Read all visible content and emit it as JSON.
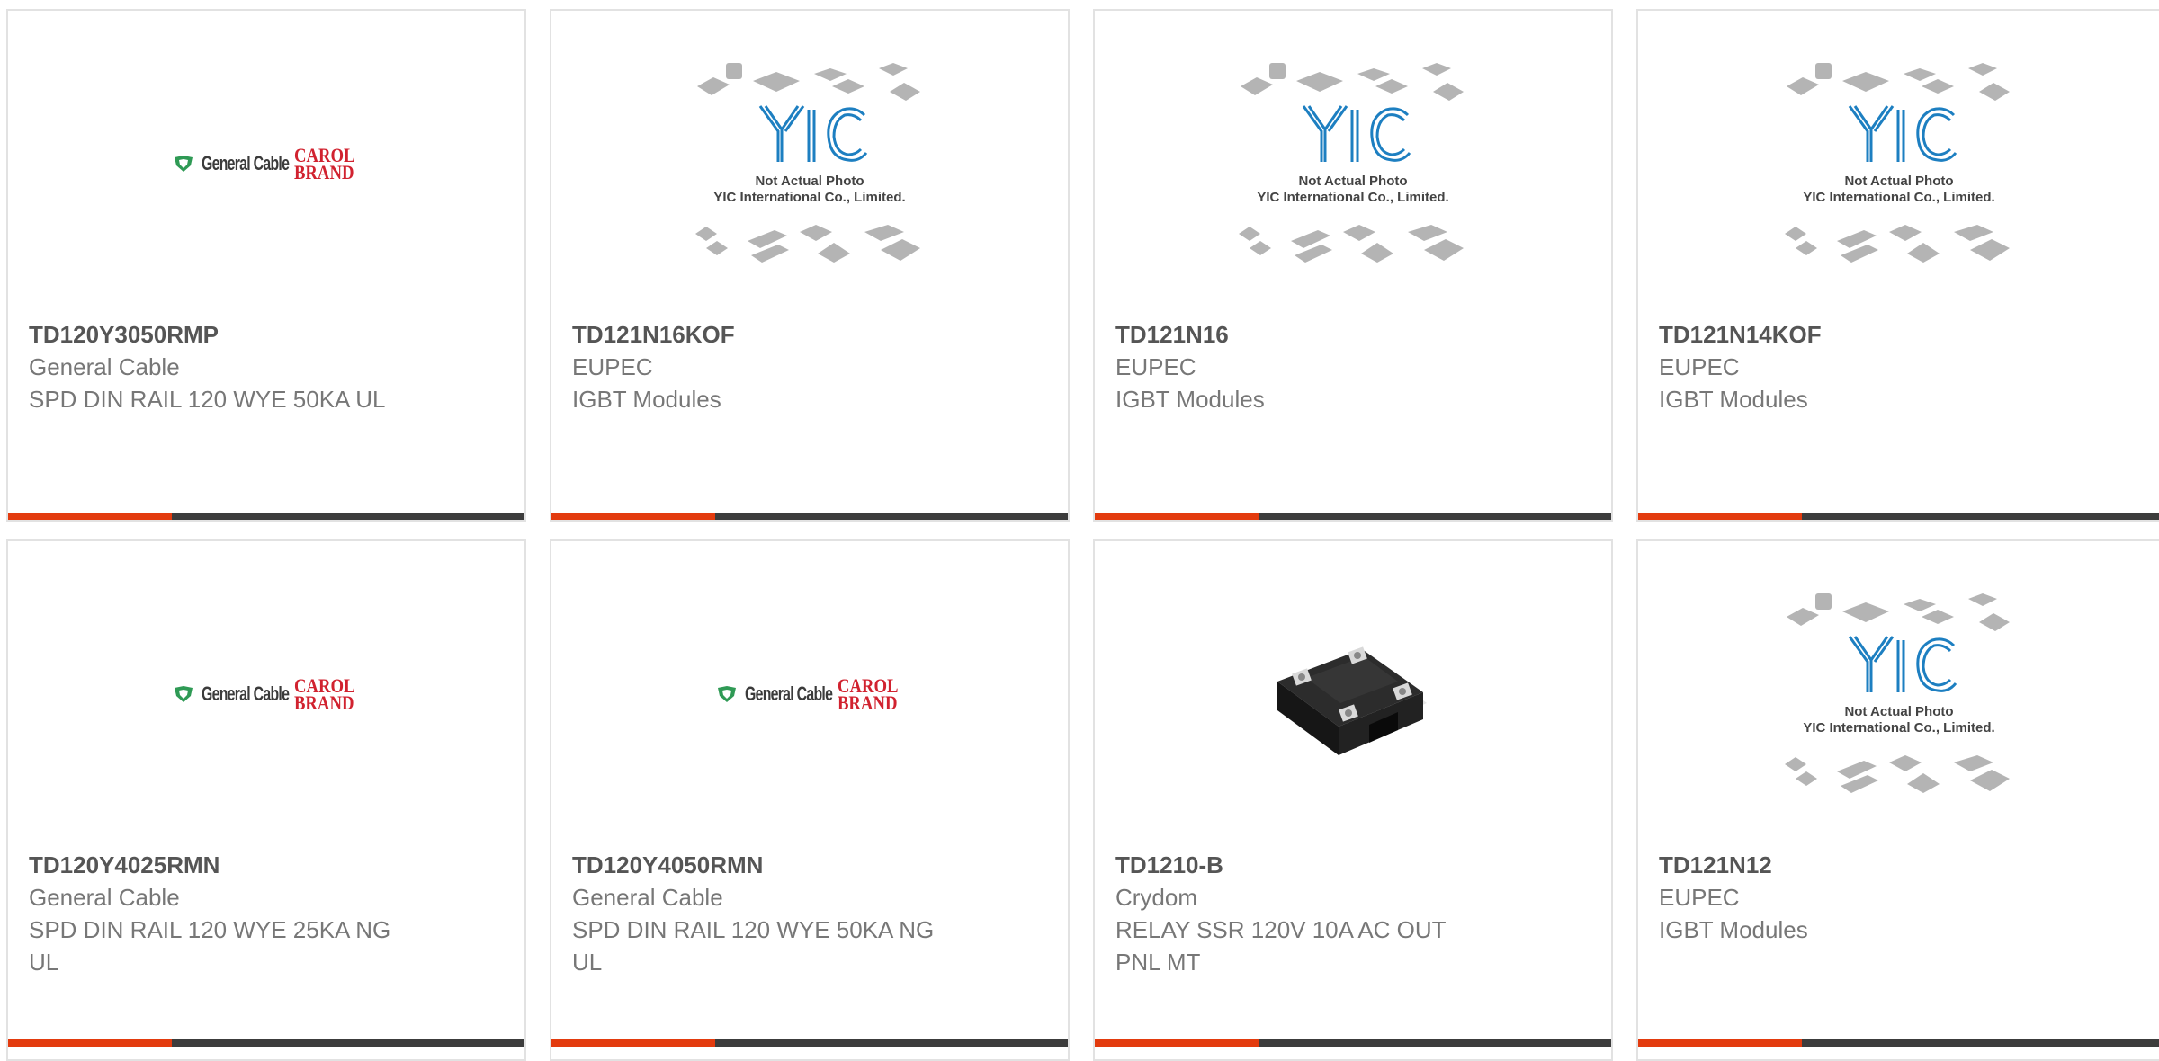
{
  "products": [
    {
      "part_number": "TD120Y3050RMP",
      "brand": "General Cable",
      "description": "SPD DIN RAIL 120 WYE 50KA UL",
      "image_type": "general-cable-logo"
    },
    {
      "part_number": "TD121N16KOF",
      "brand": "EUPEC",
      "description": "IGBT Modules",
      "image_type": "yic-placeholder"
    },
    {
      "part_number": "TD121N16",
      "brand": "EUPEC",
      "description": "IGBT Modules",
      "image_type": "yic-placeholder"
    },
    {
      "part_number": "TD121N14KOF",
      "brand": "EUPEC",
      "description": "IGBT Modules",
      "image_type": "yic-placeholder"
    },
    {
      "part_number": "TD120Y4025RMN",
      "brand": "General Cable",
      "description": "SPD DIN RAIL 120 WYE 25KA NG UL",
      "image_type": "general-cable-logo"
    },
    {
      "part_number": "TD120Y4050RMN",
      "brand": "General Cable",
      "description": "SPD DIN RAIL 120 WYE 50KA NG UL",
      "image_type": "general-cable-logo"
    },
    {
      "part_number": "TD1210-B",
      "brand": "Crydom",
      "description": "RELAY SSR 120V 10A AC OUT PNL MT",
      "image_type": "relay-photo"
    },
    {
      "part_number": "TD121N12",
      "brand": "EUPEC",
      "description": "IGBT Modules",
      "image_type": "yic-placeholder"
    }
  ],
  "logos": {
    "general_cable_text": "General Cable",
    "carol_line1": "CAROL",
    "carol_line2": "BRAND"
  },
  "placeholder": {
    "brand_mark": "YIC",
    "line1": "Not Actual Photo",
    "line2": "YIC International Co., Limited."
  },
  "colors": {
    "accent_bar": "#e33b0e",
    "dark_bar": "#3c3c3c",
    "card_border": "#e2e2e2",
    "part_number_text": "#555555",
    "body_text": "#777777",
    "yic_blue": "#1d7fc1",
    "carol_red": "#d1222f",
    "gc_green": "#2f9a55"
  }
}
